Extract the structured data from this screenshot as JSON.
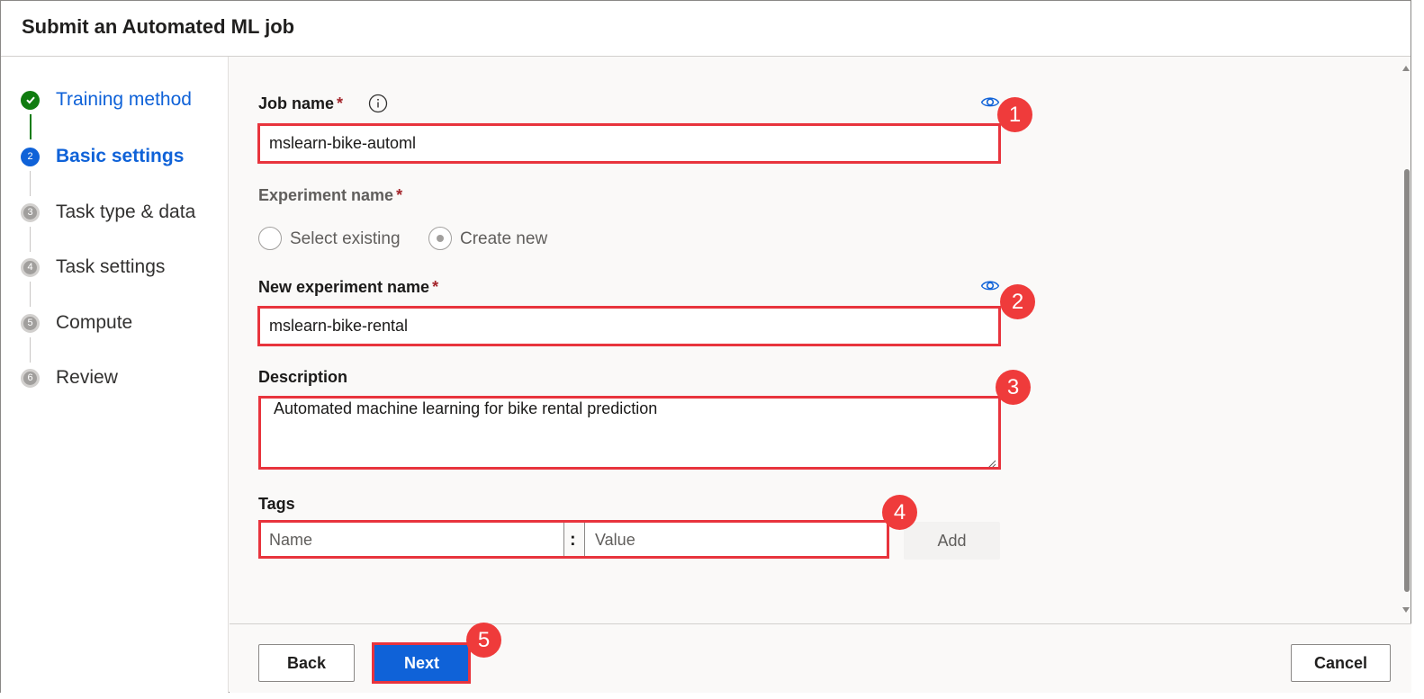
{
  "header": {
    "title": "Submit an Automated ML job"
  },
  "steps": [
    {
      "number": "✓",
      "label": "Training method",
      "state": "done"
    },
    {
      "number": "2",
      "label": "Basic settings",
      "state": "current"
    },
    {
      "number": "3",
      "label": "Task type & data",
      "state": "todo"
    },
    {
      "number": "4",
      "label": "Task settings",
      "state": "todo"
    },
    {
      "number": "5",
      "label": "Compute",
      "state": "todo"
    },
    {
      "number": "6",
      "label": "Review",
      "state": "todo"
    }
  ],
  "form": {
    "job_name": {
      "label": "Job name",
      "required": "*",
      "value": "mslearn-bike-automl"
    },
    "experiment_name": {
      "label": "Experiment name",
      "required": "*",
      "options": [
        "Select existing",
        "Create new"
      ],
      "selected": "Create new"
    },
    "new_experiment_name": {
      "label": "New experiment name",
      "required": "*",
      "value": "mslearn-bike-rental"
    },
    "description": {
      "label": "Description",
      "value": "Automated machine learning for bike rental prediction"
    },
    "tags": {
      "label": "Tags",
      "name_placeholder": "Name",
      "separator": ":",
      "value_placeholder": "Value",
      "add_label": "Add"
    }
  },
  "badges": [
    "1",
    "2",
    "3",
    "4",
    "5"
  ],
  "footer": {
    "back_label": "Back",
    "next_label": "Next",
    "cancel_label": "Cancel"
  },
  "colors": {
    "accent": "#0f62d8",
    "done": "#107c10",
    "highlight": "#e8343d",
    "badge": "#ef3b3b"
  }
}
